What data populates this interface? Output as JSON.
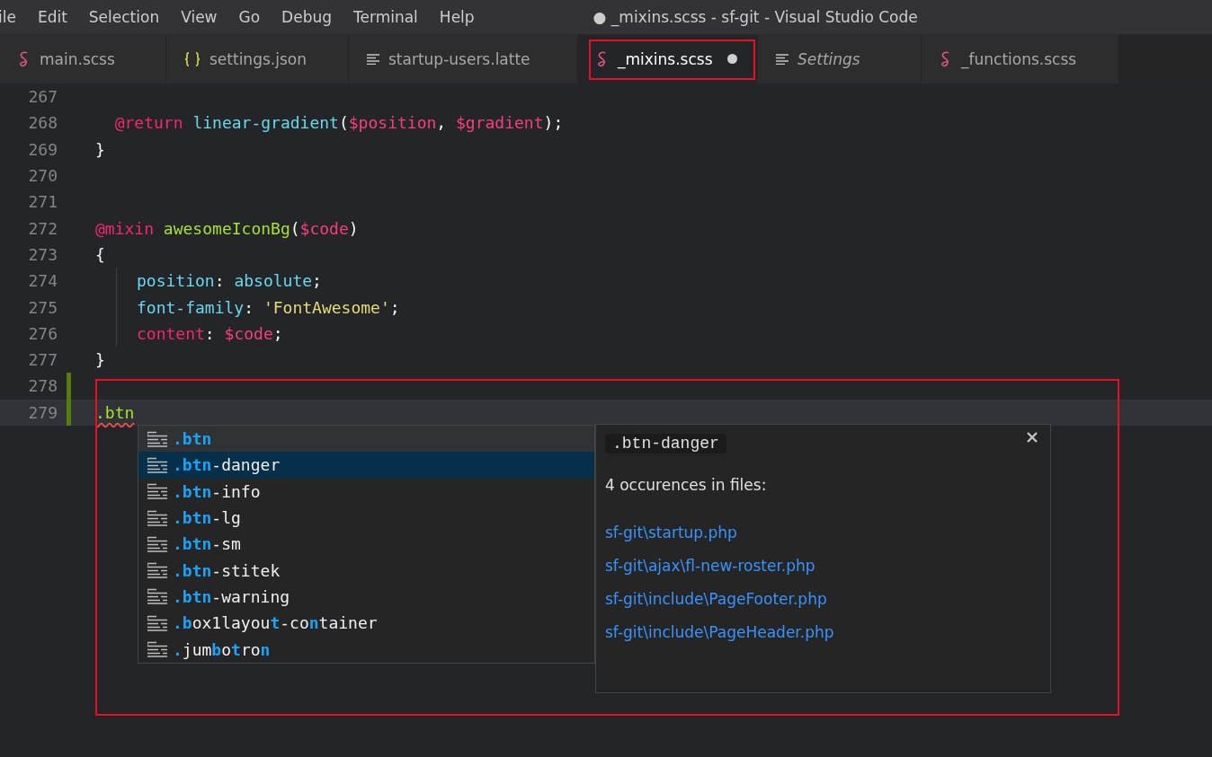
{
  "menu": [
    "ile",
    "Edit",
    "Selection",
    "View",
    "Go",
    "Debug",
    "Terminal",
    "Help"
  ],
  "window": {
    "title": "● _mixins.scss - sf-git - Visual Studio Code"
  },
  "tabs": [
    {
      "label": "main.scss",
      "kind": "sass",
      "selected": false,
      "dirty": false,
      "preview": false,
      "outlined": false
    },
    {
      "label": "settings.json",
      "kind": "json",
      "selected": false,
      "dirty": false,
      "preview": false,
      "outlined": false
    },
    {
      "label": "startup-users.latte",
      "kind": "text",
      "selected": false,
      "dirty": false,
      "preview": false,
      "outlined": false
    },
    {
      "label": "_mixins.scss",
      "kind": "sass",
      "selected": true,
      "dirty": true,
      "preview": false,
      "outlined": true
    },
    {
      "label": "Settings",
      "kind": "text",
      "selected": false,
      "dirty": false,
      "preview": true,
      "outlined": false
    },
    {
      "label": "_functions.scss",
      "kind": "sass",
      "selected": false,
      "dirty": false,
      "preview": false,
      "outlined": false
    }
  ],
  "editor": {
    "marked_region": true,
    "lines": [
      {
        "number": "267",
        "guide": false,
        "modified": false,
        "current": false
      },
      {
        "number": "268",
        "guide": false,
        "modified": false,
        "current": false,
        "tokens": [
          {
            "text": "  @return ",
            "kind": "keyword"
          },
          {
            "text": "linear-gradient",
            "kind": "func"
          },
          {
            "text": "(",
            "kind": "punct"
          },
          {
            "text": "$position",
            "kind": "var"
          },
          {
            "text": ", ",
            "kind": "punct"
          },
          {
            "text": "$gradient",
            "kind": "var"
          },
          {
            "text": ");",
            "kind": "punct"
          }
        ]
      },
      {
        "number": "269",
        "guide": false,
        "modified": false,
        "current": false,
        "tokens": [
          {
            "text": "}",
            "kind": "punct"
          }
        ]
      },
      {
        "number": "270",
        "guide": false,
        "modified": false,
        "current": false
      },
      {
        "number": "271",
        "guide": false,
        "modified": false,
        "current": false
      },
      {
        "number": "272",
        "guide": false,
        "modified": false,
        "current": false,
        "tokens": [
          {
            "text": "@mixin ",
            "kind": "keyword"
          },
          {
            "text": "awesomeIconBg",
            "kind": "name"
          },
          {
            "text": "(",
            "kind": "punct"
          },
          {
            "text": "$code",
            "kind": "var"
          },
          {
            "text": ")",
            "kind": "punct"
          }
        ]
      },
      {
        "number": "273",
        "guide": false,
        "modified": false,
        "current": false,
        "tokens": [
          {
            "text": "{",
            "kind": "punct"
          }
        ]
      },
      {
        "number": "274",
        "guide": true,
        "modified": false,
        "current": false,
        "tokens": [
          {
            "text": "position",
            "kind": "prop"
          },
          {
            "text": ": ",
            "kind": "punct"
          },
          {
            "text": "absolute",
            "kind": "prop"
          },
          {
            "text": ";",
            "kind": "punct"
          }
        ]
      },
      {
        "number": "275",
        "guide": true,
        "modified": false,
        "current": false,
        "tokens": [
          {
            "text": "font-family",
            "kind": "prop"
          },
          {
            "text": ": ",
            "kind": "punct"
          },
          {
            "text": "'FontAwesome'",
            "kind": "string"
          },
          {
            "text": ";",
            "kind": "punct"
          }
        ]
      },
      {
        "number": "276",
        "guide": true,
        "modified": false,
        "current": false,
        "tokens": [
          {
            "text": "content",
            "kind": "keyword"
          },
          {
            "text": ": ",
            "kind": "punct"
          },
          {
            "text": "$code",
            "kind": "var"
          },
          {
            "text": ";",
            "kind": "punct"
          }
        ]
      },
      {
        "number": "277",
        "guide": false,
        "modified": false,
        "current": false,
        "tokens": [
          {
            "text": "}",
            "kind": "punct"
          }
        ]
      },
      {
        "number": "278",
        "guide": false,
        "modified": true,
        "current": false
      },
      {
        "number": "279",
        "guide": false,
        "modified": true,
        "current": true,
        "tokens": [
          {
            "text": ".btn",
            "kind": "selector",
            "squiggle": true
          }
        ]
      }
    ]
  },
  "suggest": {
    "items": [
      {
        "selected": false,
        "hovered": true,
        "parts": [
          {
            "text": ".btn",
            "match": true
          }
        ]
      },
      {
        "selected": true,
        "hovered": false,
        "parts": [
          {
            "text": ".btn",
            "match": true
          },
          {
            "text": "-danger",
            "match": false
          }
        ]
      },
      {
        "selected": false,
        "hovered": false,
        "parts": [
          {
            "text": ".btn",
            "match": true
          },
          {
            "text": "-info",
            "match": false
          }
        ]
      },
      {
        "selected": false,
        "hovered": false,
        "parts": [
          {
            "text": ".btn",
            "match": true
          },
          {
            "text": "-lg",
            "match": false
          }
        ]
      },
      {
        "selected": false,
        "hovered": false,
        "parts": [
          {
            "text": ".btn",
            "match": true
          },
          {
            "text": "-sm",
            "match": false
          }
        ]
      },
      {
        "selected": false,
        "hovered": false,
        "parts": [
          {
            "text": ".btn",
            "match": true
          },
          {
            "text": "-stitek",
            "match": false
          }
        ]
      },
      {
        "selected": false,
        "hovered": false,
        "parts": [
          {
            "text": ".btn",
            "match": true
          },
          {
            "text": "-warning",
            "match": false
          }
        ]
      },
      {
        "selected": false,
        "hovered": false,
        "parts": [
          {
            "text": ".b",
            "match": true
          },
          {
            "text": "ox1layou",
            "match": false
          },
          {
            "text": "t",
            "match": true
          },
          {
            "text": "-co",
            "match": false
          },
          {
            "text": "n",
            "match": true
          },
          {
            "text": "tainer",
            "match": false
          }
        ]
      },
      {
        "selected": false,
        "hovered": false,
        "parts": [
          {
            "text": ".",
            "match": true
          },
          {
            "text": "jum",
            "match": false
          },
          {
            "text": "b",
            "match": true
          },
          {
            "text": "o",
            "match": false
          },
          {
            "text": "t",
            "match": true
          },
          {
            "text": "ro",
            "match": false
          },
          {
            "text": "n",
            "match": true
          }
        ]
      }
    ],
    "details": {
      "code": ".btn-danger",
      "heading": "4 occurences in files:",
      "links": [
        "sf-git\\startup.php",
        "sf-git\\ajax\\fl-new-roster.php",
        "sf-git\\include\\PageFooter.php",
        "sf-git\\include\\PageHeader.php"
      ]
    }
  }
}
